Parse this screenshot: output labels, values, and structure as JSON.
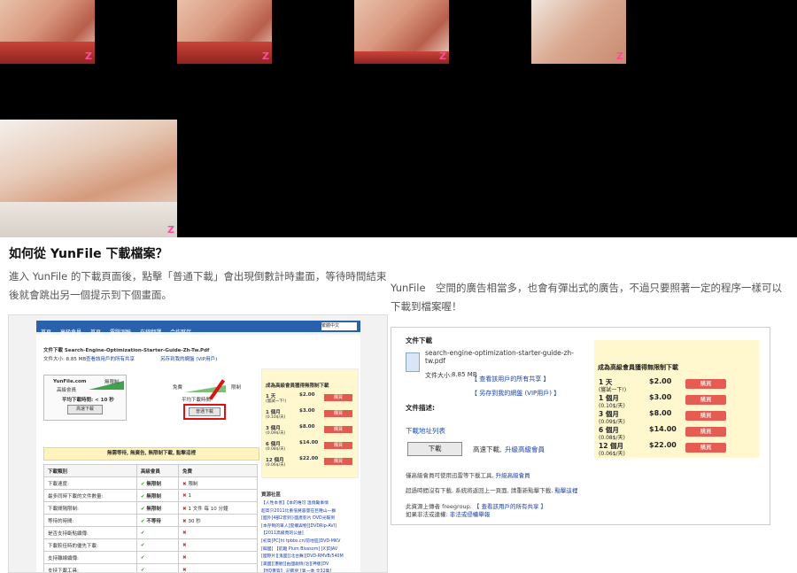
{
  "thumbnails": {
    "watermark": "Z"
  },
  "article": {
    "title": "如何從 YunFile 下載檔案？",
    "para1": "進入 YunFile 的下載頁面後，點擊「普通下載」會出現倒數計時畫面，等待時間結束後就會跳出另一個提示到下個畫面。",
    "para2": "YunFile　空間的廣告相當多，也會有彈出式的廣告，不過只要照著一定的程序一樣可以下載到檔案喔！"
  },
  "left_shot": {
    "nav": [
      "首頁",
      "高級會員",
      "首頁",
      "電腦測驗",
      "在線翻譯",
      "合作夥伴"
    ],
    "lang": "繁體中文",
    "file_title": "文件下載 Search-Engine-Optimization-Starter-Guide-Zh-Tw.Pdf",
    "size": "文件大小: 8.85 MB",
    "links": [
      "查看該用戶的所有共享",
      "另存到我的網盤 (VIP用戶)"
    ],
    "brand": "YunFile.com",
    "premium_label": "高級會員",
    "unlimited": "無限制",
    "avg_time": "平均下載時間: < 10 秒",
    "fast_btn": "高速下載",
    "free_label": "免費",
    "limited": "限制",
    "avg_free": "平均下載時間",
    "normal_btn": "普通下載",
    "premium_box_title": "成為高級會員獲得無限制下載",
    "plans": [
      {
        "term": "1 天",
        "note": "(嘗試一下!)",
        "price": "$2.00"
      },
      {
        "term": "1 個月",
        "note": "(0.10$/天)",
        "price": "$3.00"
      },
      {
        "term": "3 個月",
        "note": "(0.09$/天)",
        "price": "$8.00"
      },
      {
        "term": "6 個月",
        "note": "(0.08$/天)",
        "price": "$14.00"
      },
      {
        "term": "12 個月",
        "note": "(0.06$/天)",
        "price": "$22.00"
      }
    ],
    "buy": "購買",
    "banner": "無需等待, 無廣告, 無限制下載, 點擊這裡",
    "table_headers": [
      "下載類別",
      "高級會員",
      "免費"
    ],
    "table_rows": [
      {
        "label": "下載速度:",
        "prem": "無限制",
        "free": "限制"
      },
      {
        "label": "最多同時下載的文件數量:",
        "prem": "無限制",
        "free": "1"
      },
      {
        "label": "下載間隔限制:",
        "prem": "無限制",
        "free": "1 文件 每 10 分鐘"
      },
      {
        "label": "等待的時間:",
        "prem": "不等待",
        "free": "30 秒"
      },
      {
        "label": "是否支持斷點續傳:",
        "prem": "",
        "free": ""
      },
      {
        "label": "下載較佳時的優先下載:",
        "prem": "",
        "free": ""
      },
      {
        "label": "支持離線續傳:",
        "prem": "",
        "free": ""
      },
      {
        "label": "支持下載工具:",
        "prem": "",
        "free": ""
      }
    ],
    "community_title": "資源社區",
    "community": [
      "【人性本善】【本的唯可 溫情勵事情",
      "超高只2011比重低將容量在巨瞪山一群",
      "[國外]4部2套到]-國產影片 DVD光碟到",
      "[本存制的單人]雲鄉與物][DVDRip-AVI]",
      "【2011高級而的公益]",
      "[初高]PC[ht tpbbs.cn/前地區]DVD-MKV",
      "[韓國] 【前趣 Plum Blossom] [X]DJAV",
      "[國際片][鬼國][北台舞][DVD-RMVB/540M",
      "[美國][畫觀][由國劇情/治][神版]DV",
      "【HD畫質】 記鑑星 [第一季 全32集]"
    ]
  },
  "right_shot": {
    "section": "文件下載",
    "filename": "search-engine-optimization-starter-guide-zh-tw.pdf",
    "size_label": "文件大小:",
    "size_value": "8.85 MB",
    "link_all": "【 查看該用戶的所有共享 】",
    "link_save": "【 另存到我的網盤 (VIP用戶) 】",
    "desc_label": "文件描述:",
    "addr_label": "下載地址列表",
    "download_btn": "下載",
    "fast_text": "高速下載,",
    "upgrade_link": "升級高級會員",
    "premium_title": "成為高級會員獲得無限制下載",
    "plans": [
      {
        "term": "1 天",
        "note": "(嘗試一下!)",
        "price": "$2.00"
      },
      {
        "term": "1 個月",
        "note": "(0.10$/天)",
        "price": "$3.00"
      },
      {
        "term": "3 個月",
        "note": "(0.09$/天)",
        "price": "$8.00"
      },
      {
        "term": "6 個月",
        "note": "(0.08$/天)",
        "price": "$14.00"
      },
      {
        "term": "12 個月",
        "note": "(0.06$/天)",
        "price": "$22.00"
      }
    ],
    "buy": "購買",
    "note1_prefix": "僅高級會員可使用迅雷等下載工具,",
    "note1_link": "升級高級會員",
    "note2_prefix": "超過時間沒有下載, 系統將返回上一頁面, 請重新點擊下載,",
    "note2_link": "點擊這裡",
    "note3_prefix": "此資源上傳者 freegroup.",
    "note3_link": "【 查看該用戶的所有共享 】",
    "note4_prefix": "如果非法或違權:",
    "note4_link": "非法或侵權舉報"
  }
}
